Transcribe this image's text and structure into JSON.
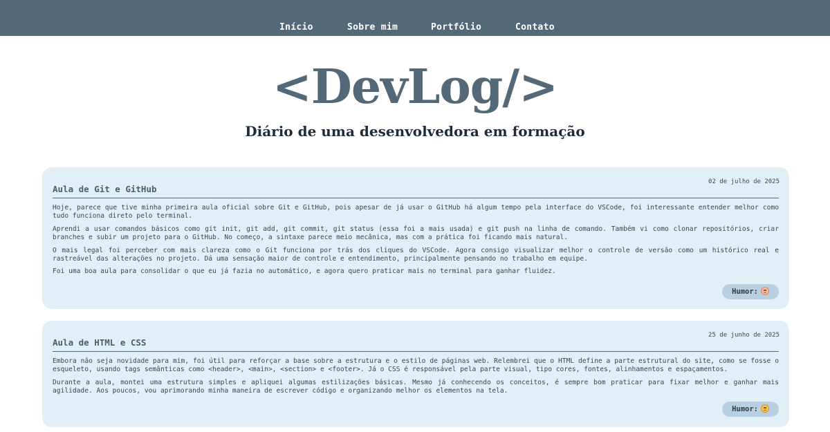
{
  "nav": {
    "items": [
      {
        "label": "Início"
      },
      {
        "label": "Sobre mim"
      },
      {
        "label": "Portfólio"
      },
      {
        "label": "Contato"
      }
    ]
  },
  "header": {
    "logo": "<DevLog/>",
    "subtitle": "Diário de uma desenvolvedora em formação"
  },
  "posts": [
    {
      "date": "02 de julho de 2025",
      "title": "Aula de Git e GitHub",
      "paragraphs": [
        "Hoje, parece que tive minha primeira aula oficial sobre Git e GitHub, pois apesar de já usar o GitHub há algum tempo pela interface do VSCode, foi interessante entender melhor como tudo funciona direto pelo terminal.",
        "Aprendi a usar comandos básicos como git init, git add, git commit, git status (essa foi a mais usada) e git push na linha de comando. Também vi como clonar repositórios, criar branches e subir um projeto para o GitHub. No começo, a sintaxe parece meio mecânica, mas com a prática foi ficando mais natural.",
        "O mais legal foi perceber com mais clareza como o Git funciona por trás dos cliques do VSCode. Agora consigo visualizar melhor o controle de versão como um histórico real e rastreável das alterações no projeto. Dá uma sensação maior de controle e entendimento, principalmente pensando no trabalho em equipe.",
        "Foi uma boa aula para consolidar o que eu já fazia no automático, e agora quero praticar mais no terminal para ganhar fluidez."
      ],
      "mood_label": "Humor:",
      "mood_icon": "smiling-face-icon"
    },
    {
      "date": "25 de junho de 2025",
      "title": "Aula de HTML e CSS",
      "paragraphs": [
        "Embora não seja novidade para mim, foi útil para reforçar a base sobre a estrutura e o estilo de páginas web. Relembrei que o HTML define a parte estrutural do site, como se fosse o esqueleto, usando tags semânticas como <header>, <main>, <section> e <footer>. Já o CSS é responsável pela parte visual, tipo cores, fontes, alinhamentos e espaçamentos.",
        "Durante a aula, montei uma estrutura simples e apliquei algumas estilizações básicas. Mesmo já conhecendo os conceitos, é sempre bom praticar para fixar melhor e ganhar mais agilidade. Aos poucos, vou aprimorando minha maneira de escrever código e organizando melhor os elementos na tela."
      ],
      "mood_label": "Humor:",
      "mood_icon": "happy-face-icon"
    }
  ],
  "colors": {
    "nav_bg": "#546977",
    "accent": "#546977",
    "card_bg": "#e3eff7",
    "mood_badge_bg": "#b9d0e2",
    "subtitle": "#1f2b3a"
  }
}
